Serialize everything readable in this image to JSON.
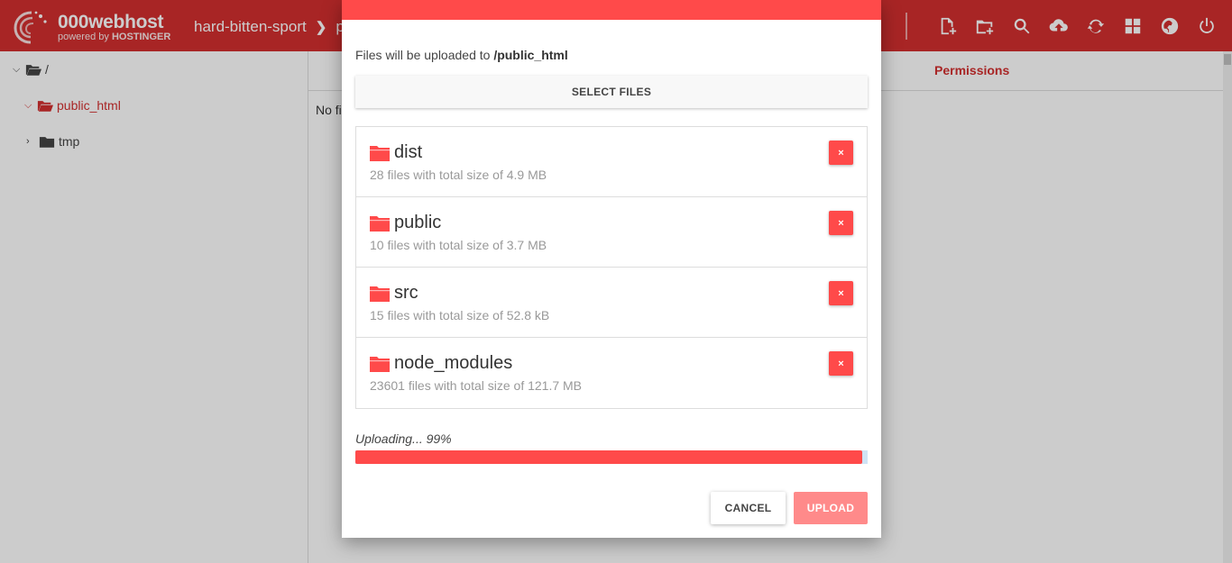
{
  "app": {
    "logo_title": "000webhost",
    "logo_sub_prefix": "powered by",
    "logo_sub_brand": "HOSTINGER",
    "site_name": "hard-bitten-sport",
    "crumb_next": "p"
  },
  "toolbar": {
    "icons": [
      "new-file-icon",
      "new-folder-icon",
      "search-icon",
      "upload-icon",
      "refresh-icon",
      "grid-view-icon",
      "globe-icon",
      "power-icon"
    ]
  },
  "tree": {
    "root": "/",
    "items": [
      {
        "label": "public_html",
        "active": true
      },
      {
        "label": "tmp",
        "active": false
      }
    ]
  },
  "main": {
    "permissions_header": "Permissions",
    "empty_text": "No fi"
  },
  "modal": {
    "dest_prefix": "Files will be uploaded to",
    "dest_path": "/public_html",
    "select_label": "SELECT FILES",
    "files": [
      {
        "name": "dist",
        "info": "28 files with total size of 4.9 MB"
      },
      {
        "name": "public",
        "info": "10 files with total size of 3.7 MB"
      },
      {
        "name": "src",
        "info": "15 files with total size of 52.8 kB"
      },
      {
        "name": "node_modules",
        "info": "23601 files with total size of 121.7 MB"
      }
    ],
    "remove_label": "×",
    "status": "Uploading... 99%",
    "progress_percent": 99,
    "cancel_label": "CANCEL",
    "upload_label": "UPLOAD"
  },
  "colors": {
    "brand": "#d32f2f",
    "accent": "#ff4a4a",
    "upload_disabled": "#ff8a8a"
  }
}
